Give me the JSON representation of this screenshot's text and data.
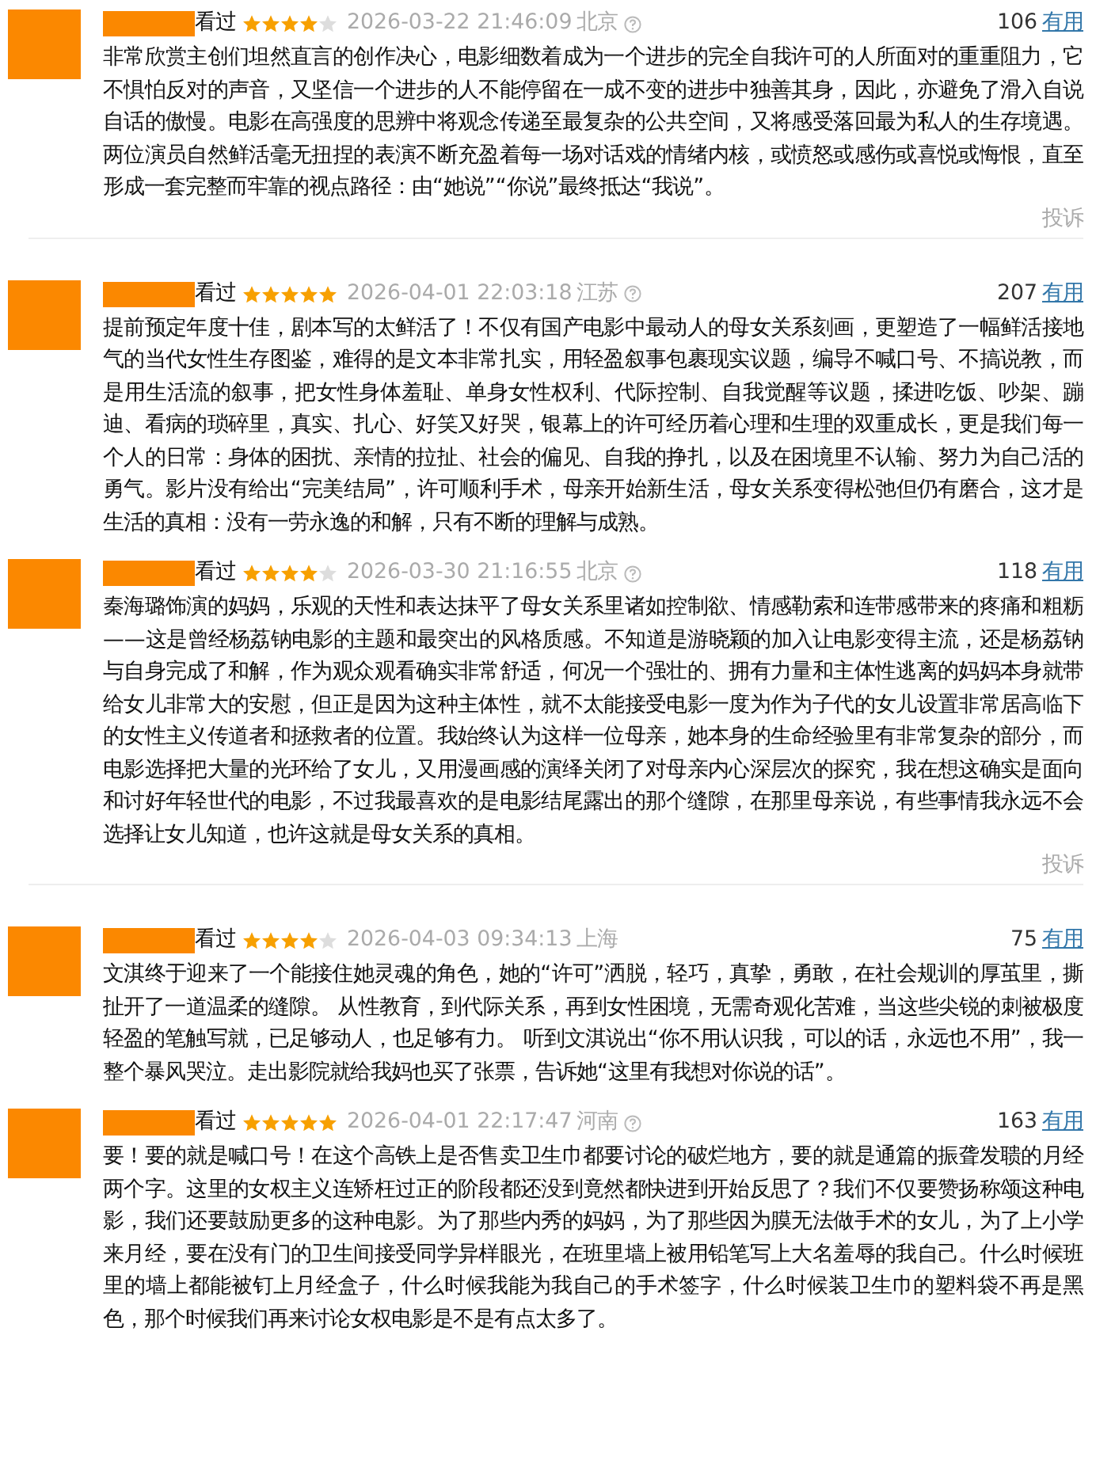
{
  "reviews": [
    {
      "status": "看过",
      "stars": 4,
      "time": "2026-03-22 21:46:09",
      "location": "北京",
      "info_icon": true,
      "votes": "106",
      "vote_label": "有用",
      "text": "非常欣赏主创们坦然直言的创作决心，电影细数着成为一个进步的完全自我许可的人所面对的重重阻力，它不惧怕反对的声音，又坚信一个进步的人不能停留在一成不变的进步中独善其身，因此，亦避免了滑入自说自话的傲慢。电影在高强度的思辨中将观念传递至最复杂的公共空间，又将感受落回最为私人的生存境遇。两位演员自然鲜活毫无扭捏的表演不断充盈着每一场对话戏的情绪内核，或愤怒或感伤或喜悦或悔恨，直至形成一套完整而牢靠的视点路径：由“她说”“你说”最终抵达“我说”。",
      "report": "投诉"
    },
    {
      "status": "看过",
      "stars": 5,
      "time": "2026-04-01 22:03:18",
      "location": "江苏",
      "info_icon": true,
      "votes": "207",
      "vote_label": "有用",
      "text": "提前预定年度十佳，剧本写的太鲜活了！不仅有国产电影中最动人的母女关系刻画，更塑造了一幅鲜活接地气的当代女性生存图鉴，难得的是文本非常扎实，用轻盈叙事包裹现实议题，编导不喊口号、不搞说教，而是用生活流的叙事，把女性身体羞耻、单身女性权利、代际控制、自我觉醒等议题，揉进吃饭、吵架、蹦迪、看病的琐碎里，真实、扎心、好笑又好哭，银幕上的许可经历着心理和生理的双重成长，更是我们每一个人的日常：身体的困扰、亲情的拉扯、社会的偏见、自我的挣扎，以及在困境里不认输、努力为自己活的勇气。影片没有给出“完美结局”，许可顺利手术，母亲开始新生活，母女关系变得松弛但仍有磨合，这才是生活的真相：没有一劳永逸的和解，只有不断的理解与成熟。"
    },
    {
      "status": "看过",
      "stars": 4,
      "time": "2026-03-30 21:16:55",
      "location": "北京",
      "info_icon": true,
      "votes": "118",
      "vote_label": "有用",
      "text": "秦海璐饰演的妈妈，乐观的天性和表达抹平了母女关系里诸如控制欲、情感勒索和连带感带来的疼痛和粗粝——这是曾经杨荔钠电影的主题和最突出的风格质感。不知道是游晓颖的加入让电影变得主流，还是杨荔钠与自身完成了和解，作为观众观看确实非常舒适，何况一个强壮的、拥有力量和主体性逃离的妈妈本身就带给女儿非常大的安慰，但正是因为这种主体性，就不太能接受电影一度为作为子代的女儿设置非常居高临下的女性主义传道者和拯救者的位置。我始终认为这样一位母亲，她本身的生命经验里有非常复杂的部分，而电影选择把大量的光环给了女儿，又用漫画感的演绎关闭了对母亲内心深层次的探究，我在想这确实是面向和讨好年轻世代的电影，不过我最喜欢的是电影结尾露出的那个缝隙，在那里母亲说，有些事情我永远不会选择让女儿知道，也许这就是母女关系的真相。",
      "report": "投诉"
    },
    {
      "status": "看过",
      "stars": 4,
      "time": "2026-04-03 09:34:13",
      "location": "上海",
      "info_icon": false,
      "votes": "75",
      "vote_label": "有用",
      "text": "文淇终于迎来了一个能接住她灵魂的角色，她的“许可”洒脱，轻巧，真挚，勇敢，在社会规训的厚茧里，撕扯开了一道温柔的缝隙。 从性教育，到代际关系，再到女性困境，无需奇观化苦难，当这些尖锐的刺被极度轻盈的笔触写就，已足够动人，也足够有力。 听到文淇说出“你不用认识我，可以的话，永远也不用”，我一整个暴风哭泣。走出影院就给我妈也买了张票，告诉她“这里有我想对你说的话”。"
    },
    {
      "status": "看过",
      "stars": 5,
      "time": "2026-04-01 22:17:47",
      "location": "河南",
      "info_icon": true,
      "votes": "163",
      "vote_label": "有用",
      "text": "要！要的就是喊口号！在这个高铁上是否售卖卫生巾都要讨论的破烂地方，要的就是通篇的振聋发聩的月经两个字。这里的女权主义连矫枉过正的阶段都还没到竟然都快进到开始反思了？我们不仅要赞扬称颂这种电影，我们还要鼓励更多的这种电影。为了那些内秀的妈妈，为了那些因为膜无法做手术的女儿，为了上小学来月经，要在没有门的卫生间接受同学异样眼光，在班里墙上被用铅笔写上大名羞辱的我自己。什么时候班里的墙上都能被钉上月经盒子，什么时候我能为我自己的手术签字，什么时候装卫生巾的塑料袋不再是黑色，那个时候我们再来讨论女权电影是不是有点太多了。"
    }
  ]
}
